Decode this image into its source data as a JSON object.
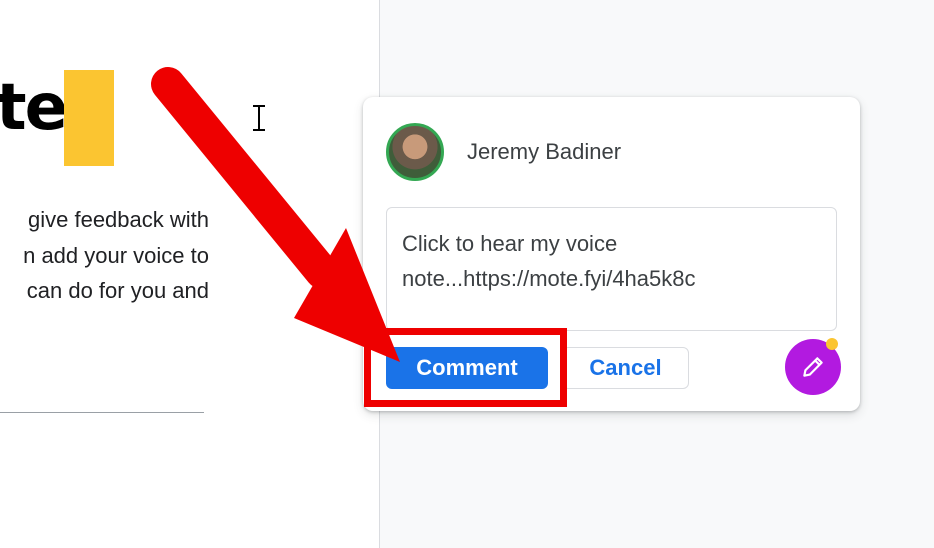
{
  "document": {
    "heading_fragment": "te",
    "body_lines": [
      "give feedback with",
      "n add your voice to",
      "can do for you and"
    ]
  },
  "comment": {
    "author_name": "Jeremy Badiner",
    "text": "Click to hear my voice note...https://mote.fyi/4ha5k8c",
    "comment_button_label": "Comment",
    "cancel_button_label": "Cancel"
  },
  "colors": {
    "accent_blue": "#1a73e8",
    "highlight_yellow": "#fbc531",
    "annotation_red": "#ee0000",
    "fab_purple": "#b21ae0"
  },
  "icons": [
    "text-cursor-icon",
    "pencil-icon",
    "red-arrow-annotation"
  ]
}
